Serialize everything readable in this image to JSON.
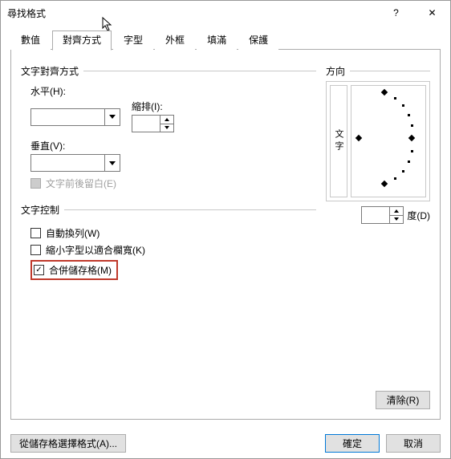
{
  "title": "尋找格式",
  "tabs": [
    "數值",
    "對齊方式",
    "字型",
    "外框",
    "填滿",
    "保護"
  ],
  "active_tab": 1,
  "align": {
    "group": "文字對齊方式",
    "h_label": "水平(H):",
    "v_label": "垂直(V):",
    "indent_label": "縮排(I):",
    "justify_label": "文字前後留白(E)"
  },
  "control": {
    "group": "文字控制",
    "wrap": "自動換列(W)",
    "shrink": "縮小字型以適合欄寬(K)",
    "merge": "合併儲存格(M)"
  },
  "orient": {
    "group": "方向",
    "vtext": "文字",
    "deg_label": "度(D)"
  },
  "clear": "清除(R)",
  "from_cell": "從儲存格選擇格式(A)...",
  "ok": "確定",
  "cancel": "取消"
}
